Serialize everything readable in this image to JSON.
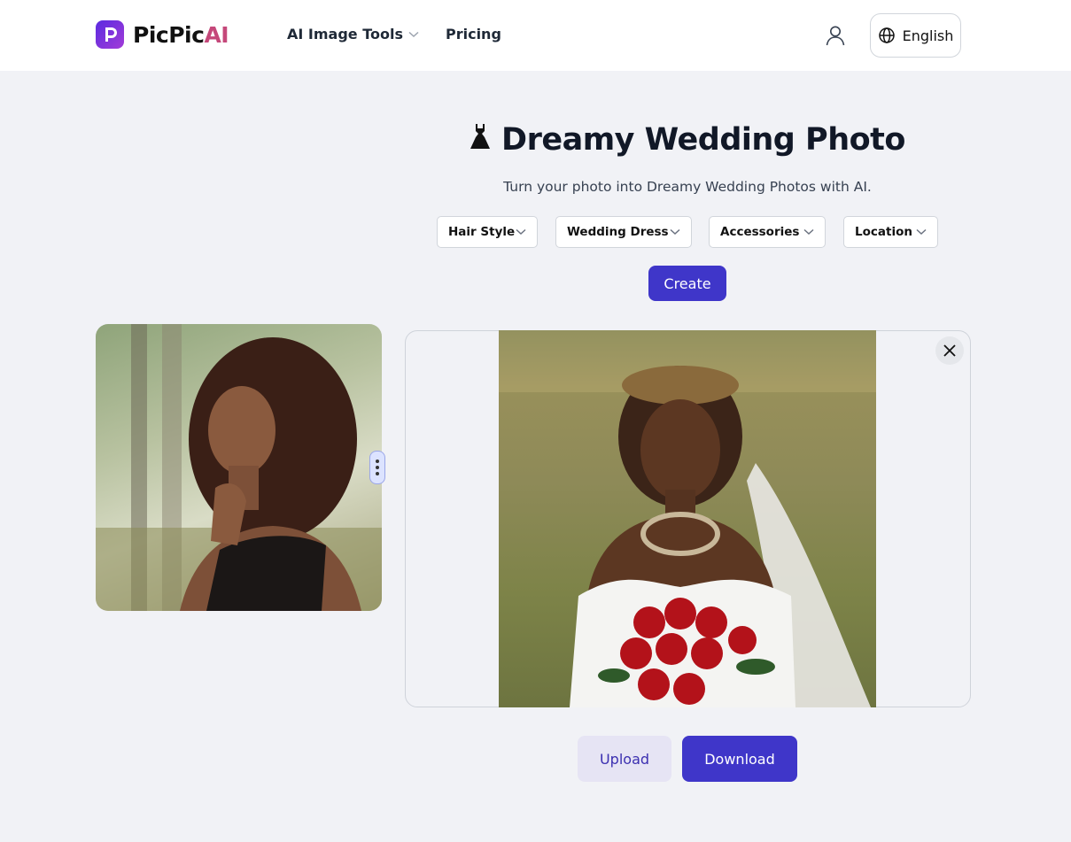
{
  "brand": {
    "name_part1": "PicPic",
    "name_part2": "AI",
    "accent_color": "#c5487a",
    "logo_gradient": [
      "#5b2be0",
      "#a23bd8"
    ]
  },
  "nav": {
    "items": [
      {
        "label": "AI Image Tools",
        "has_dropdown": true
      },
      {
        "label": "Pricing",
        "has_dropdown": false
      }
    ]
  },
  "header": {
    "language": "English",
    "user_icon": "user-icon",
    "globe_icon": "globe-icon"
  },
  "page": {
    "title": "Dreamy Wedding Photo",
    "title_icon": "dress-icon",
    "subtitle": "Turn your photo into Dreamy Wedding Photos with AI."
  },
  "options": [
    {
      "label": "Hair Style"
    },
    {
      "label": "Wedding Dress"
    },
    {
      "label": "Accessories"
    },
    {
      "label": "Location"
    }
  ],
  "actions": {
    "create": "Create",
    "upload": "Upload",
    "download": "Download"
  },
  "colors": {
    "primary": "#3f36c9",
    "secondary_bg": "#e6e4f4",
    "page_bg": "#f1f2f6"
  }
}
